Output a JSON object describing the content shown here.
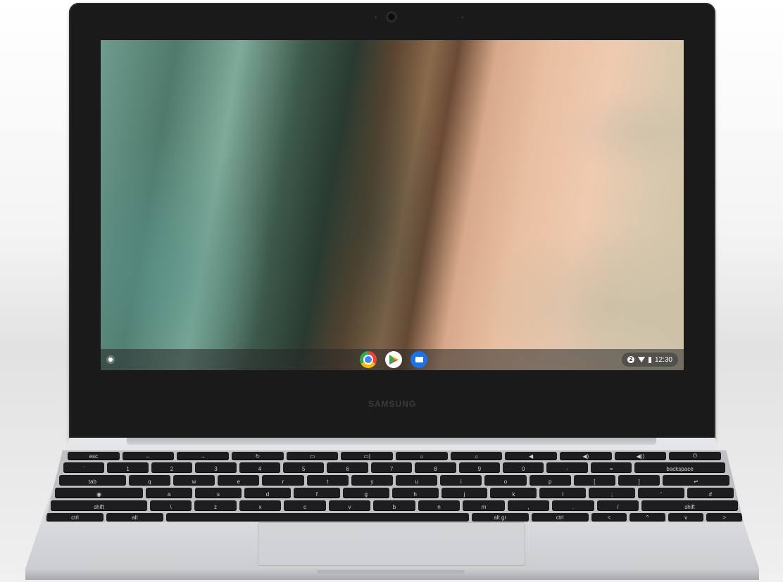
{
  "device": {
    "brand": "SAMSUNG"
  },
  "shelf": {
    "apps": [
      {
        "name": "Chrome",
        "icon": "chrome-icon"
      },
      {
        "name": "Play Store",
        "icon": "play-store-icon"
      },
      {
        "name": "Files",
        "icon": "files-icon"
      }
    ],
    "status": {
      "notification_count": "2",
      "time": "12:30"
    }
  },
  "keyboard": {
    "rows": [
      [
        "esc",
        "←",
        "→",
        "↻",
        "▭",
        "▭|",
        "☼",
        "☼",
        "◀",
        "◀)",
        "◀))",
        "⏻"
      ],
      [
        "`",
        "1",
        "2",
        "3",
        "4",
        "5",
        "6",
        "7",
        "8",
        "9",
        "0",
        "-",
        "=",
        "backspace"
      ],
      [
        "tab",
        "q",
        "w",
        "e",
        "r",
        "t",
        "y",
        "u",
        "i",
        "o",
        "p",
        "[",
        "]",
        "↵"
      ],
      [
        "◉",
        "a",
        "s",
        "d",
        "f",
        "g",
        "h",
        "j",
        "k",
        "l",
        ";",
        "'",
        "#"
      ],
      [
        "shift",
        "\\",
        "z",
        "x",
        "c",
        "v",
        "b",
        "n",
        "m",
        ",",
        ".",
        "/",
        "shift"
      ],
      [
        "ctrl",
        "alt",
        "",
        "alt gr",
        "ctrl",
        "<",
        "^",
        "v",
        ">"
      ]
    ]
  }
}
